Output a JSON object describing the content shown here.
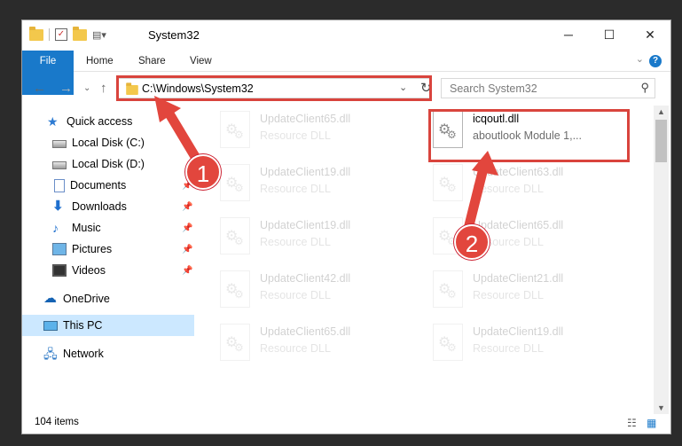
{
  "window": {
    "title": "System32"
  },
  "controls": {
    "minimize": "─",
    "maximize": "☐",
    "close": "✕"
  },
  "ribbon": {
    "tabs": [
      "File",
      "Home",
      "Share",
      "View"
    ]
  },
  "address": {
    "path": "C:\\Windows\\System32"
  },
  "search": {
    "placeholder": "Search System32"
  },
  "sidebar": {
    "items": [
      {
        "label": "Quick access",
        "icon": "quick-access-icon"
      },
      {
        "label": "Local Disk (C:)",
        "icon": "drive-icon"
      },
      {
        "label": "Local Disk (D:)",
        "icon": "drive-icon"
      },
      {
        "label": "Documents",
        "icon": "documents-icon"
      },
      {
        "label": "Downloads",
        "icon": "downloads-icon"
      },
      {
        "label": "Music",
        "icon": "music-icon"
      },
      {
        "label": "Pictures",
        "icon": "pictures-icon"
      },
      {
        "label": "Videos",
        "icon": "videos-icon"
      },
      {
        "label": "OneDrive",
        "icon": "onedrive-icon"
      },
      {
        "label": "This PC",
        "icon": "this-pc-icon"
      },
      {
        "label": "Network",
        "icon": "network-icon"
      }
    ]
  },
  "files": [
    {
      "name": "UpdateClient65.dll",
      "desc": "Resource DLL"
    },
    {
      "name": "icqoutl.dll",
      "desc": "aboutlook Module 1,..."
    },
    {
      "name": "UpdateClient19.dll",
      "desc": "Resource DLL"
    },
    {
      "name": "UpdateClient63.dll",
      "desc": "Resource DLL"
    },
    {
      "name": "UpdateClient19.dll",
      "desc": "Resource DLL"
    },
    {
      "name": "UpdateClient65.dll",
      "desc": "Resource DLL"
    },
    {
      "name": "UpdateClient42.dll",
      "desc": "Resource DLL"
    },
    {
      "name": "UpdateClient21.dll",
      "desc": "Resource DLL"
    },
    {
      "name": "UpdateClient65.dll",
      "desc": "Resource DLL"
    },
    {
      "name": "UpdateClient19.dll",
      "desc": "Resource DLL"
    }
  ],
  "status": {
    "count": "104 items"
  },
  "annotations": {
    "step1": "1",
    "step2": "2"
  },
  "colors": {
    "accent": "#1979ca",
    "highlight": "#d9443d",
    "selection": "#cce8ff"
  }
}
